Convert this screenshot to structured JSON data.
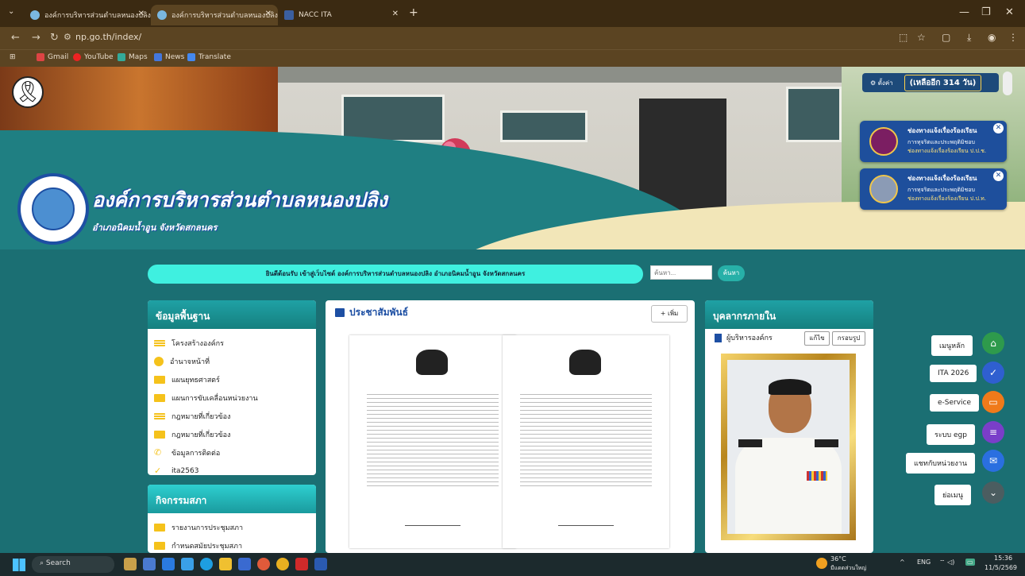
{
  "browser": {
    "tabs": [
      {
        "label": "องค์การบริหารส่วนตำบลหนองปลิง อำ",
        "active": false
      },
      {
        "label": "องค์การบริหารส่วนตำบลหนองปลิง อำ",
        "active": true
      },
      {
        "label": "NACC ITA",
        "active": false
      }
    ],
    "url": "np.go.th/index/",
    "bookmarks": [
      "Gmail",
      "YouTube",
      "Maps",
      "News",
      "Translate"
    ]
  },
  "header": {
    "org_name": "องค์การบริหารส่วนตำบลหนองปลิง",
    "org_location": "อำเภอนิคมน้ำอูน จังหวัดสกลนคร",
    "settings_label": "ตั้งค่า",
    "days_left": "(เหลืออีก 314 วัน)"
  },
  "notifications": [
    {
      "title": "ช่องทางแจ้งเรื่องร้องเรียน",
      "subtitle": "การทุจริตและประพฤติมิชอบ",
      "agency": "ช่องทางแจ้งเรื่องร้องเรียน ป.ป.ช."
    },
    {
      "title": "ช่องทางแจ้งเรื่องร้องเรียน",
      "subtitle": "การทุจริตและประพฤติมิชอบ",
      "agency": "ช่องทางแจ้งเรื่องร้องเรียน ป.ป.ท."
    }
  ],
  "search": {
    "welcome": "ยินดีต้อนรับ เข้าสู่เว็บไซต์ องค์การบริหารส่วนตำบลหนองปลิง อำเภอนิคมน้ำอูน จังหวัดสกลนคร",
    "placeholder": "ค้นหา...",
    "button": "ค้นหา"
  },
  "basic_info": {
    "title": "ข้อมูลพื้นฐาน",
    "items": [
      "โครงสร้างองค์กร",
      "อำนาจหน้าที่",
      "แผนยุทธศาสตร์",
      "แผนการขับเคลื่อนหน่วยงาน",
      "กฎหมายที่เกี่ยวข้อง",
      "กฎหมายที่เกี่ยวข้อง",
      "ข้อมูลการติดต่อ",
      "ita2563"
    ]
  },
  "council": {
    "title": "กิจกรรมสภา",
    "items": [
      "รายงานการประชุมสภา",
      "กำหนดสมัยประชุมสภา"
    ]
  },
  "pr": {
    "title": "ประชาสัมพันธ์",
    "add_label": "เพิ่ม"
  },
  "personnel": {
    "title": "บุคลากรภายใน",
    "subtitle": "ผู้บริหารองค์กร",
    "edit_label": "แก้ไข",
    "frame_label": "กรอบรูป"
  },
  "side_menu": [
    {
      "label": "เมนูหลัก",
      "color": "#2e9a4c",
      "icon": "⌂"
    },
    {
      "label": "ITA 2026",
      "color": "#2f5fd0",
      "icon": "✓"
    },
    {
      "label": "e-Service",
      "color": "#f07a1a",
      "icon": "▭"
    },
    {
      "label": "ระบบ egp",
      "color": "#7a3ec9",
      "icon": "≡"
    },
    {
      "label": "แชทกับหน่วยงาน",
      "color": "#2a6fe0",
      "icon": "✉"
    },
    {
      "label": "ย่อเมนู",
      "color": "#4b5d60",
      "icon": "⌄"
    }
  ],
  "taskbar": {
    "search": "Search",
    "weather_temp": "36°C",
    "weather_desc": "มีแดดส่วนใหญ่",
    "lang": "ENG",
    "time": "15:36",
    "date": "11/5/2569"
  }
}
